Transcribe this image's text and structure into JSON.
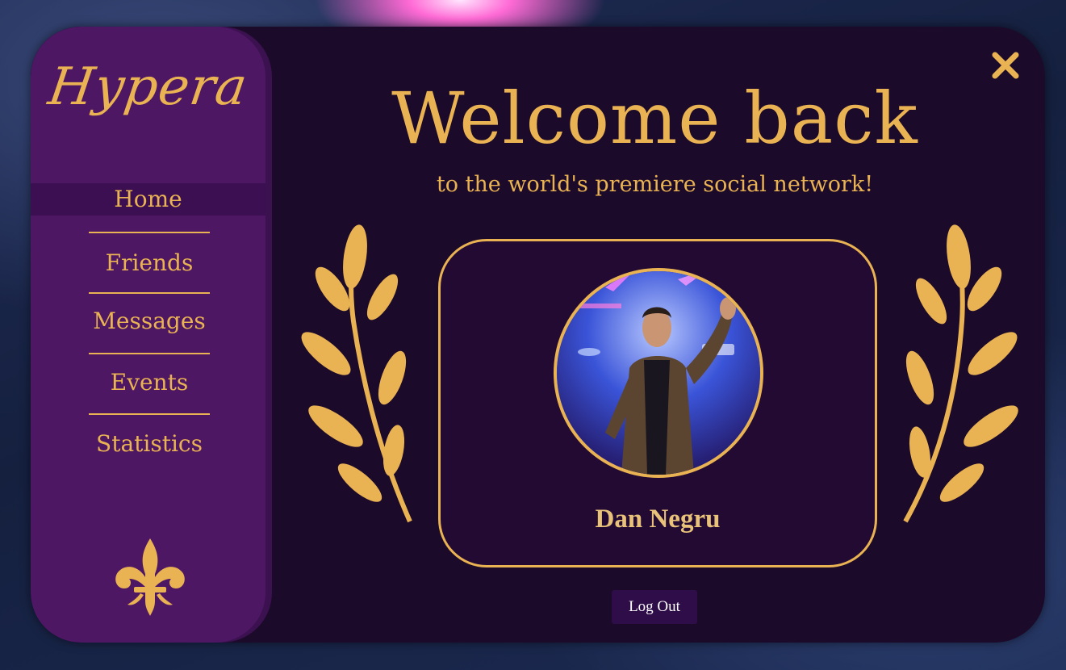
{
  "app": {
    "logo": "Hypera"
  },
  "nav": {
    "items": [
      {
        "label": "Home",
        "active": true
      },
      {
        "label": "Friends"
      },
      {
        "label": "Messages"
      },
      {
        "label": "Events"
      },
      {
        "label": "Statistics"
      }
    ]
  },
  "header": {
    "title": "Welcome back",
    "subtitle": "to the world's premiere social network!"
  },
  "profile": {
    "name": "Dan Negru"
  },
  "actions": {
    "logout_label": "Log Out"
  },
  "colors": {
    "accent": "#e9b252",
    "sidebar": "#4d1764",
    "panel": "#1c0a2a",
    "active_nav": "#3b0f52"
  },
  "icons": {
    "close": "close-icon",
    "fleur": "fleur-de-lis-icon",
    "laurel": "laurel-branch-icon"
  }
}
